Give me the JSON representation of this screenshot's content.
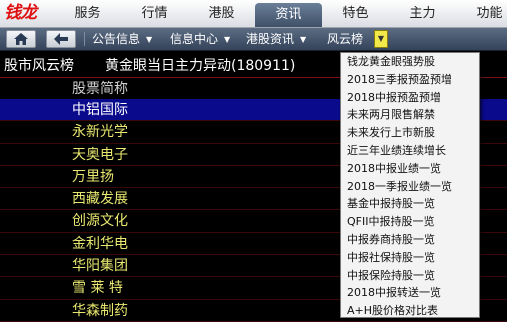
{
  "app": {
    "logo_text": "钱龙"
  },
  "top_tabs": [
    {
      "label": "服务",
      "active": false
    },
    {
      "label": "行情",
      "active": false
    },
    {
      "label": "港股",
      "active": false
    },
    {
      "label": "资讯",
      "active": true
    },
    {
      "label": "特色",
      "active": false
    },
    {
      "label": "主力",
      "active": false
    },
    {
      "label": "功能",
      "active": false
    }
  ],
  "toolbar": {
    "home_icon": "home-icon",
    "back_icon": "back-arrow-icon",
    "menus": [
      {
        "label": "公告信息"
      },
      {
        "label": "信息中心"
      },
      {
        "label": "港股资讯"
      },
      {
        "label": "风云榜"
      }
    ],
    "dropdown_toggle": "▼"
  },
  "page": {
    "section_title": "股市风云榜",
    "report_title": "黄金眼当日主力异动(180911)"
  },
  "table": {
    "column_header": "股票简称",
    "rows": [
      "中铝国际",
      "永新光学",
      "天奥电子",
      "万里扬",
      "西藏发展",
      "创源文化",
      "金利华电",
      "华阳集团",
      "雪 莱 特",
      "华森制药"
    ],
    "selected_index": 0
  },
  "dropdown": {
    "items": [
      "钱龙黄金眼强势股",
      "2018三季报预盈预增",
      "2018中报预盈预增",
      "未来两月限售解禁",
      "未来发行上市新股",
      "近三年业绩连续增长",
      "2018中报业绩一览",
      "2018一季报业绩一览",
      "基金中报持股一览",
      "QFII中报持股一览",
      "中报券商持股一览",
      "中报社保持股一览",
      "中报保险持股一览",
      "2018中报转送一览",
      "A+H股价格对比表"
    ]
  },
  "colors": {
    "selected_row_bg": "#0a0a8c",
    "stock_name_text": "#e8e870",
    "logo_red": "#e01010",
    "toggle_yellow": "#f1e84a"
  }
}
